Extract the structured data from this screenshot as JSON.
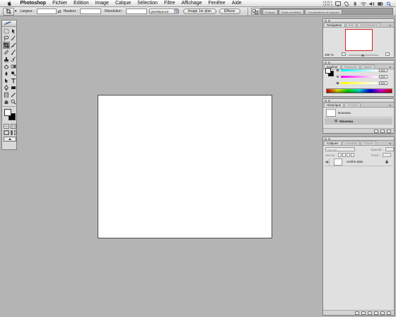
{
  "menubar": {
    "menus": [
      "Photoshop",
      "Fichier",
      "Edition",
      "Image",
      "Calque",
      "Sélection",
      "Filtre",
      "Affichage",
      "Fenêtre",
      "Aide"
    ],
    "clock_line1": "13.03.1",
    "clock_line2": "13:31 h"
  },
  "options": {
    "largeur_label": "Largeur :",
    "hauteur_label": "Hauteur :",
    "resolution_label": "Résolution :",
    "largeur_value": "",
    "hauteur_value": "",
    "resolution_value": "",
    "unit_select": "pixels/pouce",
    "front_image_button": "Image 1er plan",
    "clear_button": "Effacer",
    "well_tabs": [
      "Formes",
      "Outils prédéfinis",
      "Compositions de calques"
    ]
  },
  "navigator": {
    "tabs": [
      "Navigateur",
      "Info",
      "Informations"
    ],
    "zoom": "100 %"
  },
  "color": {
    "tabs": [
      "Couleur",
      "Nuancier",
      "Styles"
    ],
    "channels": [
      {
        "label": "R",
        "value": "255",
        "color": "#ff0000"
      },
      {
        "label": "V",
        "value": "255",
        "color": "#00ff00"
      },
      {
        "label": "B",
        "value": "255",
        "color": "#0000ff"
      }
    ]
  },
  "history": {
    "tabs": [
      "Historique",
      "Actions"
    ],
    "snapshot_label": "Nouveau",
    "step_label": "Nouveau"
  },
  "layers": {
    "tabs": [
      "Calques",
      "Couches",
      "Tracés"
    ],
    "blend_mode": "Normal",
    "opacity_label": "Opacité :",
    "lock_label": "Verrou :",
    "fill_label": "Fond :",
    "layer_name": "Arrière-plan"
  },
  "colors": {
    "desktop": "#b4b4b4",
    "canvas": "#ffffff",
    "nav_frame": "#d42020"
  }
}
